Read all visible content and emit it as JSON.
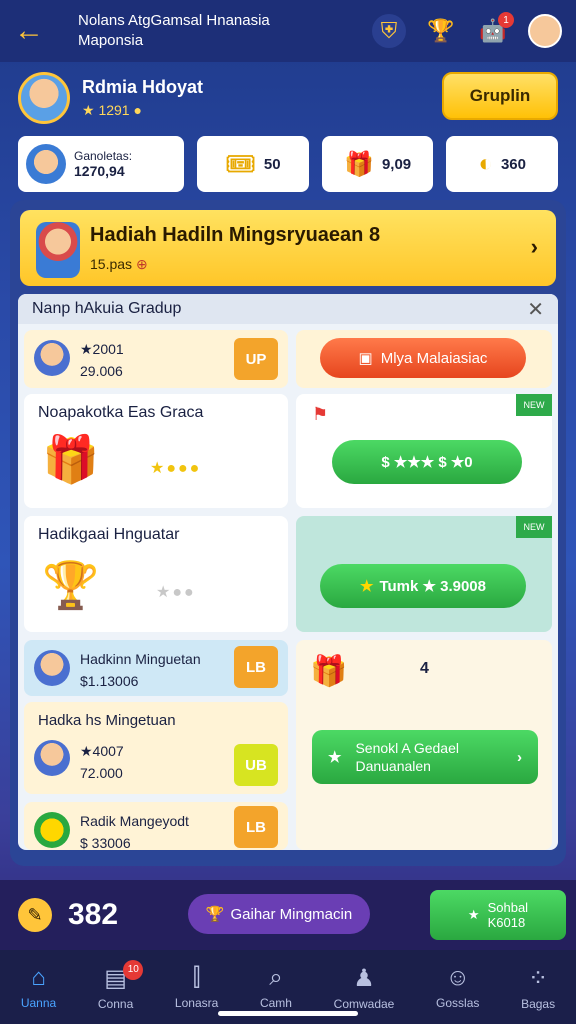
{
  "header": {
    "back_icon": "arrow-left-icon",
    "title_line1": "Nolans AtgGamsal Hnanasia",
    "title_line2": "Maponsia",
    "notification_count": "1"
  },
  "profile": {
    "name": "Rdmia Hdoyat",
    "score": "1291",
    "group_button": "Gruplin"
  },
  "stats": [
    {
      "label": "Ganoletas:",
      "value": "1270,94",
      "icon": "avatar"
    },
    {
      "value": "50",
      "icon": "ticket-icon"
    },
    {
      "value": "9,09",
      "icon": "gift-icon"
    },
    {
      "value": "360",
      "icon": "coin-icon"
    }
  ],
  "banner": {
    "title": "Hadiah Hadiln Mingsryuaean 8",
    "subtitle": "15.pas"
  },
  "list": {
    "header": "Nanp hAkuia Gradup",
    "rows": [
      {
        "line1": "★2001",
        "line2": "29.006",
        "btn": "UP"
      },
      {
        "title": "Noapakotka Eas Graca",
        "rating": "★●●●"
      },
      {
        "title": "Hadikgaai Hnguatar",
        "rating": "★●●"
      },
      {
        "line1": "Hadkinn Minguetan",
        "line2": "$1.13006",
        "btn": "LB"
      },
      {
        "line1": "Hadka hs Mingetuan",
        "line2": "★4007",
        "line3": "72.000",
        "btn": "UB"
      },
      {
        "line1": "Radik Mangeyodt",
        "line2": "$ 33006",
        "btn": "LB"
      }
    ],
    "right": {
      "red_button": "Mlya Malaiasiac",
      "green_rating": "$ ★★★ $ ★0",
      "green_button": "Tumk ★ 3.9008",
      "counter": "4",
      "bottom_button_line1": "Senokl A Gedael",
      "bottom_button_line2": "Danuanalen"
    }
  },
  "bottom": {
    "score": "382",
    "purple_button": "Gaihar Mingmacin",
    "green_button_line1": "Sohbal",
    "green_button_line2": "K6018"
  },
  "nav": [
    {
      "label": "Uanna",
      "icon": "home-icon",
      "active": true
    },
    {
      "label": "Conna",
      "icon": "card-icon",
      "badge": "10"
    },
    {
      "label": "Lonasra",
      "icon": "chart-icon"
    },
    {
      "label": "Camh",
      "icon": "search-icon"
    },
    {
      "label": "Comwadae",
      "icon": "person-icon"
    },
    {
      "label": "Gosslas",
      "icon": "group-icon"
    },
    {
      "label": "Bagas",
      "icon": "grid-icon"
    }
  ]
}
